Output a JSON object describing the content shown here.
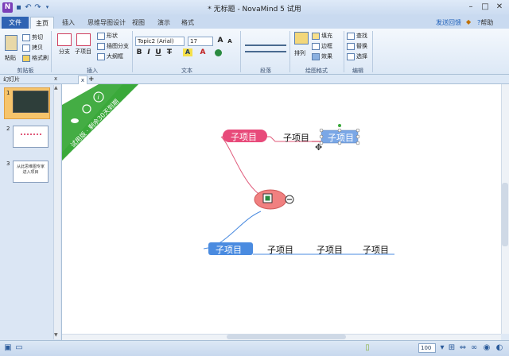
{
  "titlebar": {
    "app_icon": "N",
    "title": "* 无标题 - NovaMind 5 试用",
    "minimize": "–",
    "maximize": "□",
    "close": "✕"
  },
  "tabs": {
    "file": "文件",
    "items": [
      "主页",
      "插入",
      "思维导图设计",
      "视图",
      "演示",
      "格式"
    ],
    "active": "主页"
  },
  "ribbon_right": {
    "link": "发送回馈",
    "help": "帮助"
  },
  "ribbon": {
    "clipboard": {
      "paste": "粘贴",
      "cut": "剪切",
      "copy": "拷贝",
      "format_painter": "格式刷",
      "label": "剪贴板"
    },
    "insert": {
      "branch": "分支",
      "subtopic": "子项目",
      "shape": "形状",
      "floating_branch": "插图分支",
      "outline": "大纲框",
      "label": "插入"
    },
    "text": {
      "font": "Topic2 (Arial)",
      "size": "17",
      "bold": "B",
      "italic": "I",
      "underline": "U",
      "strike": "T",
      "label": "文本"
    },
    "paragraph": {
      "label": "段落"
    },
    "style": {
      "arrange": "排列",
      "fill": "填充",
      "border": "边框",
      "effect": "效果",
      "label": "绘图格式"
    },
    "edit": {
      "find": "查找",
      "replace": "替换",
      "select": "选择",
      "label": "编辑"
    }
  },
  "panel": {
    "title": "幻灯片",
    "close": "x",
    "slides": [
      "1",
      "2",
      "3"
    ],
    "slide3_text": "从此思维图专家进入项目"
  },
  "doc_tab": {
    "close": "x",
    "add": "+"
  },
  "banner": {
    "text": "试用版 · 剩余30天到期"
  },
  "mindmap": {
    "central_icon": "map-icon",
    "collapse": "−",
    "nodes": [
      {
        "label": "子项目",
        "style": "pink-pill"
      },
      {
        "label": "子项目",
        "style": "plain"
      },
      {
        "label": "子项目",
        "style": "selected"
      },
      {
        "label": "子项目",
        "style": "blue-pill"
      },
      {
        "label": "子项目",
        "style": "plain"
      },
      {
        "label": "子项目",
        "style": "plain"
      },
      {
        "label": "子项目",
        "style": "plain"
      }
    ]
  },
  "statusbar": {
    "zoom": "100"
  },
  "colors": {
    "accent": "#2f63b3",
    "pink": "#e84a7a",
    "blue": "#4a8be0",
    "banner": "#3aa93a",
    "central": "#f08080"
  }
}
